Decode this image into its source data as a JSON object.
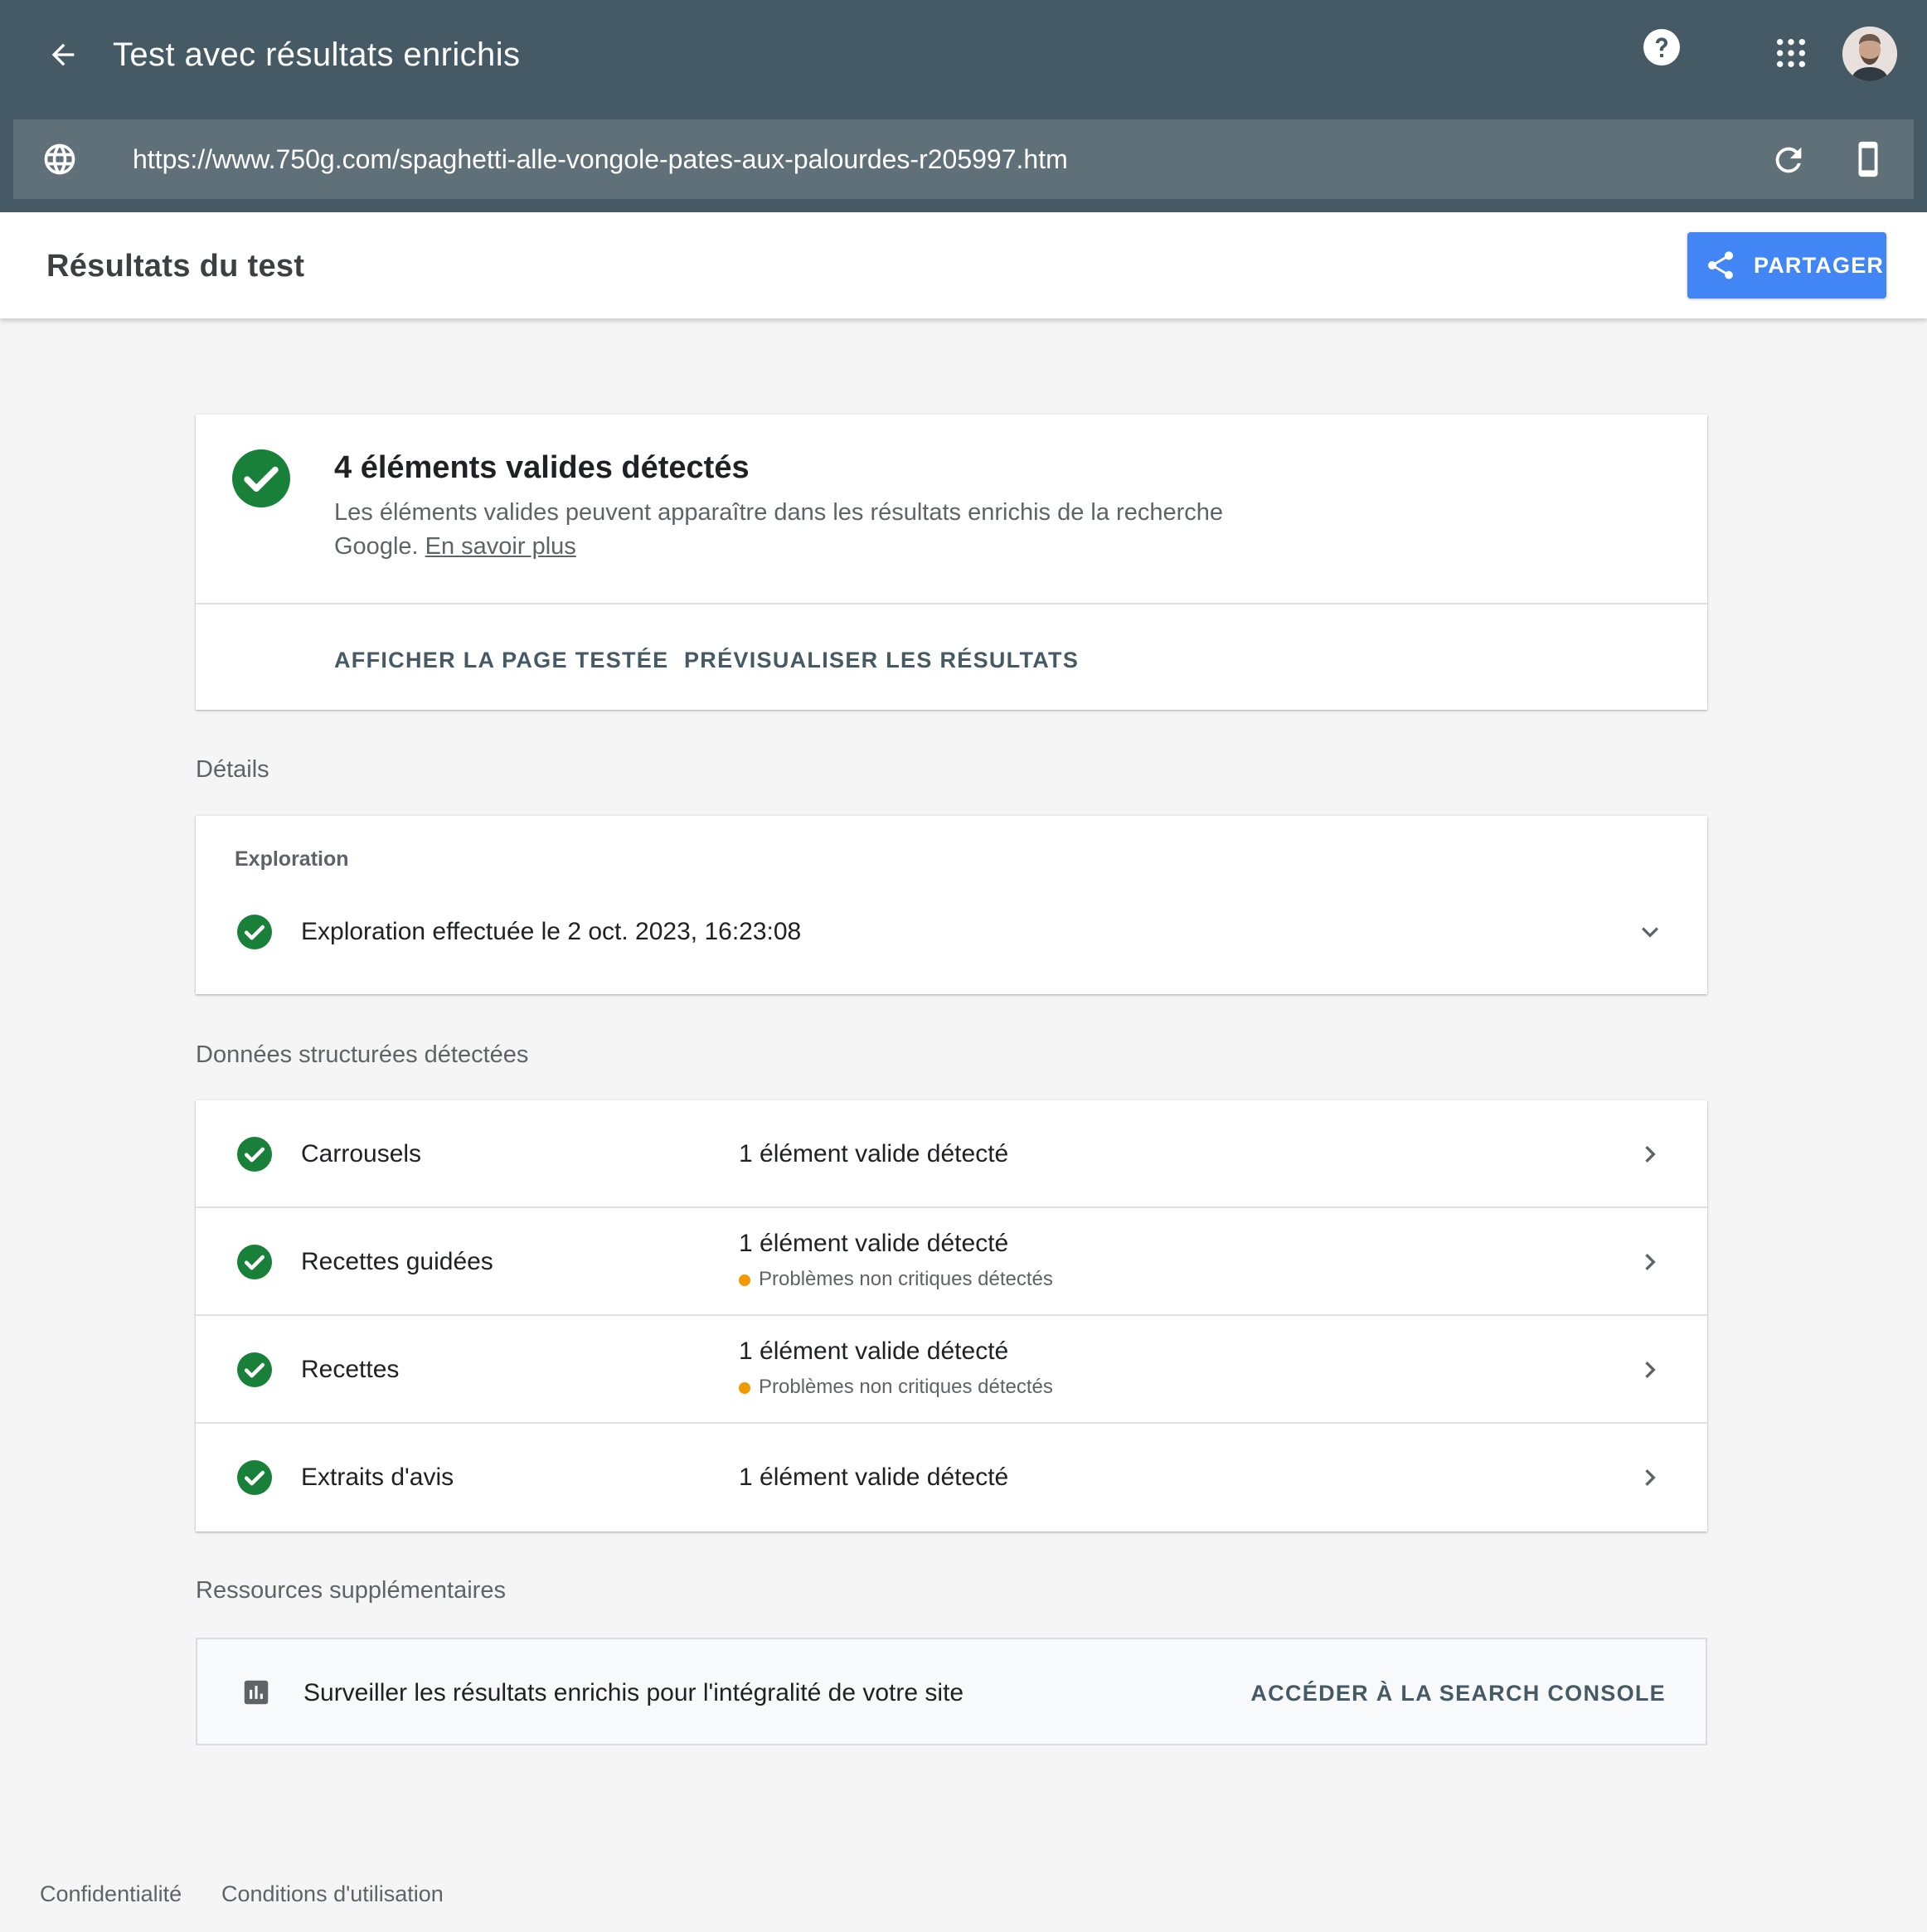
{
  "header": {
    "title": "Test avec résultats enrichis",
    "url": "https://www.750g.com/spaghetti-alle-vongole-pates-aux-palourdes-r205997.htm"
  },
  "results_header": {
    "title": "Résultats du test",
    "share_label": "PARTAGER"
  },
  "summary": {
    "title": "4 éléments valides détectés",
    "description": "Les éléments valides peuvent apparaître dans les résultats enrichis de la recherche Google.",
    "learn_more": "En savoir plus",
    "actions": [
      "AFFICHER LA PAGE TESTÉE",
      "PRÉVISUALISER LES RÉSULTATS"
    ]
  },
  "details": {
    "section_label": "Détails",
    "exploration_label": "Exploration",
    "exploration_text": "Exploration effectuée le 2 oct. 2023, 16:23:08"
  },
  "structured_data": {
    "section_label": "Données structurées détectées",
    "items": [
      {
        "name": "Carrousels",
        "status": "1 élément valide détecté",
        "warning": ""
      },
      {
        "name": "Recettes guidées",
        "status": "1 élément valide détecté",
        "warning": "Problèmes non critiques détectés"
      },
      {
        "name": "Recettes",
        "status": "1 élément valide détecté",
        "warning": "Problèmes non critiques détectés"
      },
      {
        "name": "Extraits d'avis",
        "status": "1 élément valide détecté",
        "warning": ""
      }
    ]
  },
  "resources": {
    "section_label": "Ressources supplémentaires",
    "text": "Surveiller les résultats enrichis pour l'intégralité de votre site",
    "action": "ACCÉDER À LA SEARCH CONSOLE"
  },
  "footer": {
    "links": [
      "Confidentialité",
      "Conditions d'utilisation"
    ]
  },
  "colors": {
    "header_bg": "#455a64",
    "url_bar_bg": "#607079",
    "share_button": "#4285f4",
    "success": "#188038",
    "warning": "#f29900",
    "action_text": "#455a64"
  },
  "icons": {
    "back": "arrow-left-icon",
    "help": "help-circle-icon",
    "apps": "apps-grid-icon",
    "globe": "globe-icon",
    "refresh": "refresh-icon",
    "device": "smartphone-icon",
    "share": "share-icon",
    "check": "check-circle-icon",
    "chevron_down": "chevron-down-icon",
    "chevron_right": "chevron-right-icon",
    "chart": "bar-chart-icon"
  }
}
